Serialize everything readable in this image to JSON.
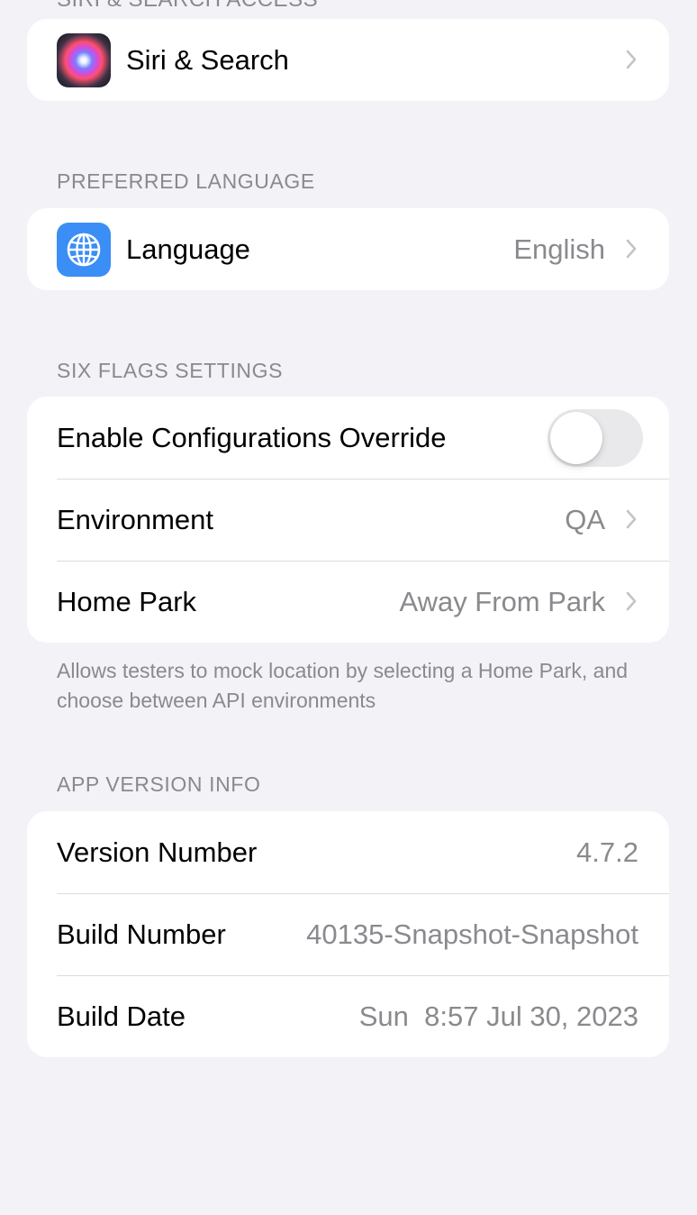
{
  "top_cut_text": "SIRI & SEARCH ACCESS",
  "siri_section": {
    "items": [
      {
        "label": "Siri & Search",
        "icon": "siri-icon"
      }
    ]
  },
  "language_section": {
    "header": "PREFERRED LANGUAGE",
    "items": [
      {
        "label": "Language",
        "value": "English",
        "icon": "globe-icon"
      }
    ]
  },
  "six_flags_section": {
    "header": "SIX FLAGS SETTINGS",
    "items": [
      {
        "label": "Enable Configurations Override",
        "toggle": false
      },
      {
        "label": "Environment",
        "value": "QA"
      },
      {
        "label": "Home Park",
        "value": "Away From Park"
      }
    ],
    "footer": "Allows testers to mock location by selecting a Home Park, and choose between API environments"
  },
  "app_version_section": {
    "header": "APP VERSION INFO",
    "items": [
      {
        "label": "Version Number",
        "value": "4.7.2"
      },
      {
        "label": "Build Number",
        "value": "40135-Snapshot-Snapshot"
      },
      {
        "label": "Build Date",
        "value": "Sun  8:57 Jul 30, 2023"
      }
    ]
  },
  "colors": {
    "background": "#f2f2f7",
    "card": "#ffffff",
    "secondary_text": "#8a8a8e",
    "separator": "#dcdce0",
    "globe_icon_bg": "#3a8ef6",
    "toggle_off": "#e9e9eb",
    "chevron": "#c4c4c7"
  }
}
